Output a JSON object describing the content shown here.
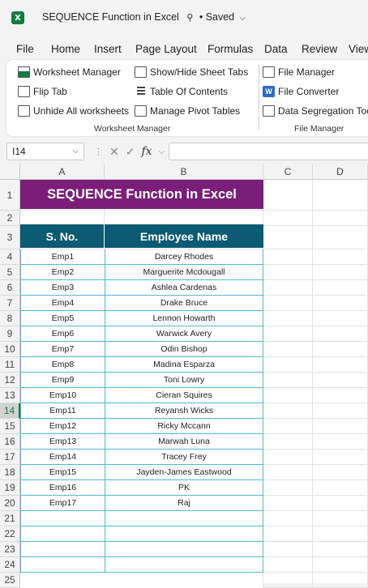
{
  "app": {
    "title": "SEQUENCE Function in Excel",
    "saved_status": "• Saved"
  },
  "menu_tabs": [
    "File",
    "Home",
    "Insert",
    "Page Layout",
    "Formulas",
    "Data",
    "Review",
    "View"
  ],
  "ribbon": {
    "worksheet_group": {
      "label": "Worksheet Manager",
      "items": [
        "Worksheet Manager",
        "Show/Hide Sheet Tabs",
        "Flip Tab",
        "Table Of Contents",
        "Unhide All worksheets",
        "Manage Pivot Tables"
      ]
    },
    "file_group": {
      "label": "File Manager",
      "items": [
        "File Manager",
        "File Converter",
        "Data Segregation Tool"
      ]
    }
  },
  "formula_bar": {
    "name_box": "I14",
    "fx_label": "fx",
    "formula": ""
  },
  "columns": [
    "A",
    "B",
    "C",
    "D"
  ],
  "rows": [
    "1",
    "2",
    "3",
    "4",
    "5",
    "6",
    "7",
    "8",
    "9",
    "10",
    "11",
    "12",
    "13",
    "14",
    "15",
    "16",
    "17",
    "18",
    "19",
    "20",
    "21",
    "22",
    "23",
    "24",
    "25"
  ],
  "selected_row": "14",
  "sheet": {
    "title": "SEQUENCE Function in Excel",
    "headers": [
      "S. No.",
      "Employee Name"
    ],
    "data": [
      [
        "Emp1",
        "Darcey Rhodes"
      ],
      [
        "Emp2",
        "Marguerite Mcdougall"
      ],
      [
        "Emp3",
        "Ashlea Cardenas"
      ],
      [
        "Emp4",
        "Drake Bruce"
      ],
      [
        "Emp5",
        "Lennon Howarth"
      ],
      [
        "Emp6",
        "Warwick Avery"
      ],
      [
        "Emp7",
        "Odin Bishop"
      ],
      [
        "Emp8",
        "Madina Esparza"
      ],
      [
        "Emp9",
        "Toni Lowry"
      ],
      [
        "Emp10",
        "Cieran Squires"
      ],
      [
        "Emp11",
        "Reyansh Wicks"
      ],
      [
        "Emp12",
        "Ricky Mccann"
      ],
      [
        "Emp13",
        "Marwah Luna"
      ],
      [
        "Emp14",
        "Tracey Frey"
      ],
      [
        "Emp15",
        "Jayden-James Eastwood"
      ],
      [
        "Emp16",
        "PK"
      ],
      [
        "Emp17",
        "Raj"
      ]
    ]
  },
  "colors": {
    "title_fill": "#7b1e79",
    "header_fill": "#0d5a73",
    "table_border": "#4fb9d3",
    "excel_green": "#107c41"
  }
}
